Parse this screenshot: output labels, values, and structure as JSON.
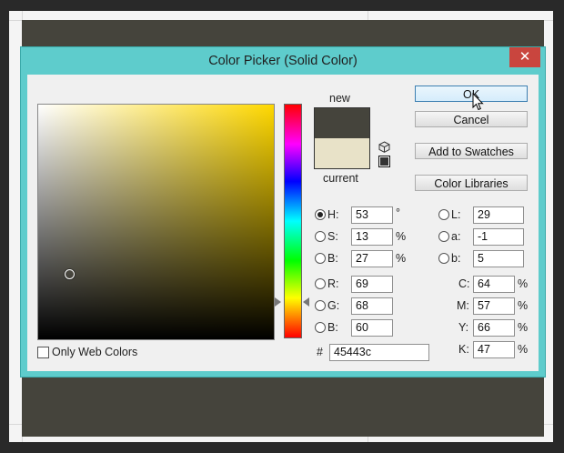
{
  "dialog": {
    "title": "Color Picker (Solid Color)",
    "close_label": "✕"
  },
  "swatch": {
    "new_label": "new",
    "current_label": "current",
    "new_color": "#45443c",
    "current_color": "#e8e2c8"
  },
  "buttons": {
    "ok": "OK",
    "cancel": "Cancel",
    "add_to_swatches": "Add to Swatches",
    "color_libraries": "Color Libraries"
  },
  "hsb": {
    "h_label": "H:",
    "h_value": "53",
    "h_unit": "°",
    "s_label": "S:",
    "s_value": "13",
    "s_unit": "%",
    "b_label": "B:",
    "b_value": "27",
    "b_unit": "%"
  },
  "rgb": {
    "r_label": "R:",
    "r_value": "69",
    "g_label": "G:",
    "g_value": "68",
    "b_label": "B:",
    "b_value": "60"
  },
  "lab": {
    "l_label": "L:",
    "l_value": "29",
    "a_label": "a:",
    "a_value": "-1",
    "b_label": "b:",
    "b_value": "5"
  },
  "cmyk": {
    "c_label": "C:",
    "c_value": "64",
    "m_label": "M:",
    "m_value": "57",
    "y_label": "Y:",
    "y_value": "66",
    "k_label": "K:",
    "k_value": "47",
    "unit": "%"
  },
  "hex": {
    "label": "#",
    "value": "45443c"
  },
  "web_colors": {
    "label": "Only Web Colors",
    "checked": false
  },
  "colors": {
    "document_bg": "#45443c",
    "dialog_frame": "#5ecccc",
    "close_button": "#c9453e"
  },
  "icons": [
    "close-icon",
    "cube-warning-icon",
    "web-safe-swatch-icon",
    "cursor-icon"
  ]
}
